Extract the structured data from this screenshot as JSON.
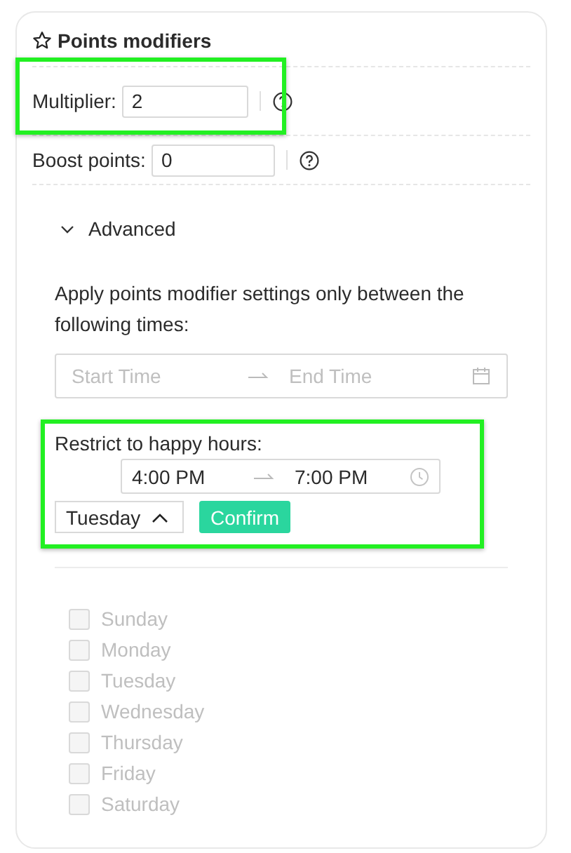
{
  "panel": {
    "title": "Points modifiers"
  },
  "fields": [
    {
      "label": "Multiplier:",
      "value": "2",
      "highlighted": true
    },
    {
      "label": "Boost points:",
      "value": "0",
      "highlighted": false
    }
  ],
  "advanced": {
    "label": "Advanced",
    "expanded": true,
    "description": "Apply points modifier settings only between the following times:",
    "date_range": {
      "start_placeholder": "Start Time",
      "end_placeholder": "End Time"
    },
    "happy_hours": {
      "label": "Restrict to happy hours:",
      "highlighted": true,
      "start": "4:00 PM",
      "end": "7:00 PM",
      "day_select": {
        "value": "Tuesday",
        "expanded": true
      },
      "confirm": "Confirm"
    },
    "days": [
      {
        "label": "Sunday",
        "checked": false,
        "disabled": true
      },
      {
        "label": "Monday",
        "checked": false,
        "disabled": true
      },
      {
        "label": "Tuesday",
        "checked": false,
        "disabled": true
      },
      {
        "label": "Wednesday",
        "checked": false,
        "disabled": true
      },
      {
        "label": "Thursday",
        "checked": false,
        "disabled": true
      },
      {
        "label": "Friday",
        "checked": false,
        "disabled": true
      },
      {
        "label": "Saturday",
        "checked": false,
        "disabled": true
      }
    ]
  }
}
